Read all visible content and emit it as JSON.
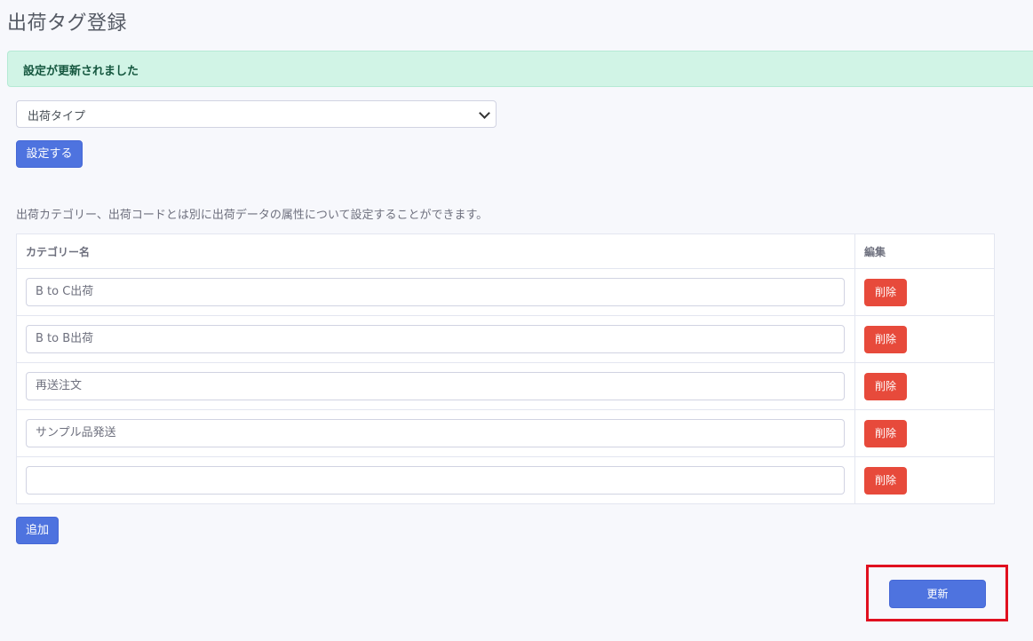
{
  "page": {
    "title": "出荷タグ登録"
  },
  "alert": {
    "message": "設定が更新されました"
  },
  "type_select": {
    "selected": "出荷タイプ"
  },
  "buttons": {
    "set_label": "設定する",
    "add_label": "追加",
    "update_label": "更新",
    "delete_label": "削除"
  },
  "description": "出荷カテゴリー、出荷コードとは別に出荷データの属性について設定することができます。",
  "table": {
    "headers": [
      "カテゴリー名",
      "編集"
    ],
    "rows": [
      {
        "value": "B to C出荷"
      },
      {
        "value": "B to B出荷"
      },
      {
        "value": "再送注文"
      },
      {
        "value": "サンプル品発送"
      },
      {
        "value": ""
      }
    ]
  },
  "colors": {
    "primary": "#4e73df",
    "danger": "#e74a3b",
    "success_bg": "#d1f4e6",
    "highlight": "#e0101f"
  }
}
